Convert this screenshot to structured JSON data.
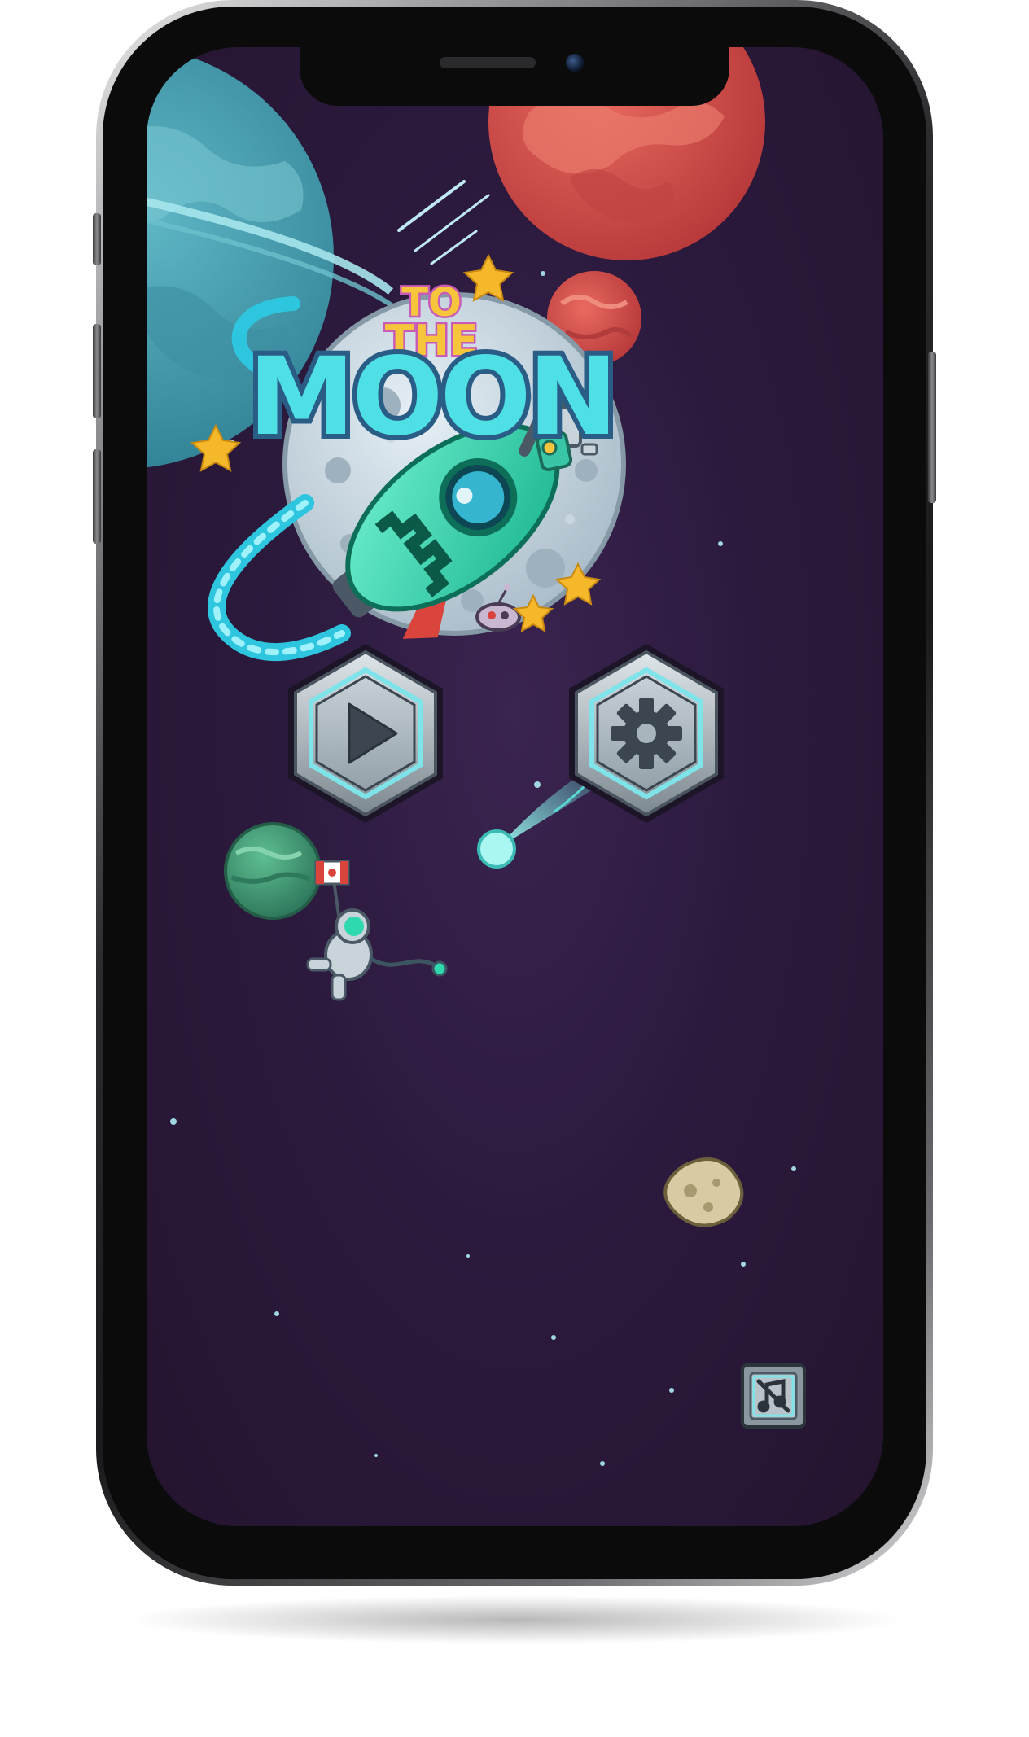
{
  "game": {
    "title_line1": "TO",
    "title_line2": "THE",
    "title_line3": "MOON"
  },
  "buttons": {
    "play": {
      "icon": "play-icon"
    },
    "settings": {
      "icon": "gear-icon"
    },
    "music": {
      "icon": "music-mute-icon"
    }
  },
  "colors": {
    "background": "#2c1a3e",
    "title_cyan": "#4fe0e6",
    "title_yellow": "#f6c53c",
    "title_magenta": "#c95bb6",
    "rocket_green": "#2ed9b0",
    "planet_red": "#d9504b",
    "planet_blue": "#4aa3b4",
    "planet_green": "#3f9a78",
    "star_yellow": "#f6b82b"
  }
}
